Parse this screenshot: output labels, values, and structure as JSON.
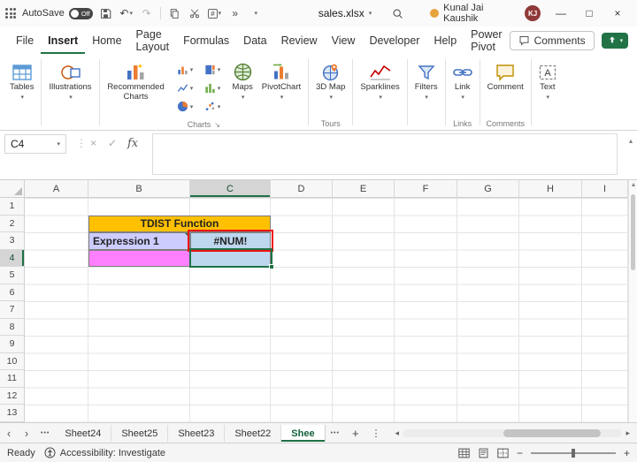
{
  "titlebar": {
    "autosave_label": "AutoSave",
    "autosave_state": "Off",
    "filename": "sales.xlsx",
    "user_name": "Kunal Jai Kaushik",
    "user_initials": "KJ"
  },
  "glyphs": {
    "dropdown": "▾",
    "undo": "↶",
    "redo": "↷",
    "hash": "#",
    "more_commands": "»",
    "kebab": "⋮",
    "minimize": "—",
    "maximize": "□",
    "close": "×",
    "collapse_formula_bar": "▴",
    "nav_prev": "‹",
    "nav_next": "›",
    "tab_overflow": "•••",
    "add_sheet": "+",
    "scroll_left": "◂",
    "scroll_right": "▸",
    "scroll_up": "▲",
    "zoom_out": "−",
    "zoom_in": "+",
    "dialog_launcher": "↘"
  },
  "menu": {
    "items": [
      "File",
      "Insert",
      "Home",
      "Page Layout",
      "Formulas",
      "Data",
      "Review",
      "View",
      "Developer",
      "Help",
      "Power Pivot"
    ],
    "active_item": "Insert",
    "comments_label": "Comments"
  },
  "ribbon": {
    "tables": "Tables",
    "illustrations": "Illustrations",
    "recommended_charts": "Recommended Charts",
    "maps": "Maps",
    "pivotchart": "PivotChart",
    "map_3d": "3D Map",
    "sparklines": "Sparklines",
    "filters": "Filters",
    "link": "Link",
    "comment": "Comment",
    "text": "Text",
    "group_charts": "Charts",
    "group_tours": "Tours",
    "group_links": "Links",
    "group_comments": "Comments"
  },
  "formula_bar": {
    "name_box": "C4",
    "fx_label": "fx",
    "value": ""
  },
  "grid": {
    "columns": [
      "A",
      "B",
      "C",
      "D",
      "E",
      "F",
      "G",
      "H",
      "I"
    ],
    "rows": [
      "1",
      "2",
      "3",
      "4",
      "5",
      "6",
      "7",
      "8",
      "9",
      "10",
      "11",
      "12",
      "13"
    ],
    "cells": {
      "title": {
        "text": "TDIST Function",
        "bg": "#FFC000",
        "range": "B2:C2"
      },
      "expression": {
        "text": "Expression 1",
        "bg": "#CCCCFF",
        "cell": "B3"
      },
      "error": {
        "text": "#NUM!",
        "bg": "#BDD7EE",
        "cell": "C3"
      },
      "input_cell": {
        "text": "",
        "bg": "#FF80FF",
        "cell": "B4"
      },
      "selected_cell": {
        "text": "",
        "bg": "#BDD7EE",
        "cell": "C4"
      }
    },
    "selection": {
      "cell": "C4",
      "column": "C",
      "row": "4"
    }
  },
  "sheet_tabs": {
    "tabs": [
      "Sheet24",
      "Sheet25",
      "Sheet23",
      "Sheet22"
    ],
    "active_tab": "Shee"
  },
  "status_bar": {
    "mode": "Ready",
    "accessibility": "Accessibility: Investigate"
  },
  "colors": {
    "accent_green": "#217346",
    "selection_border": "#1e7145",
    "error_highlight": "#ff0000",
    "title_fill": "#FFC000",
    "expression_fill": "#CCCCFF",
    "error_fill": "#BDD7EE",
    "input_fill": "#FF80FF"
  }
}
